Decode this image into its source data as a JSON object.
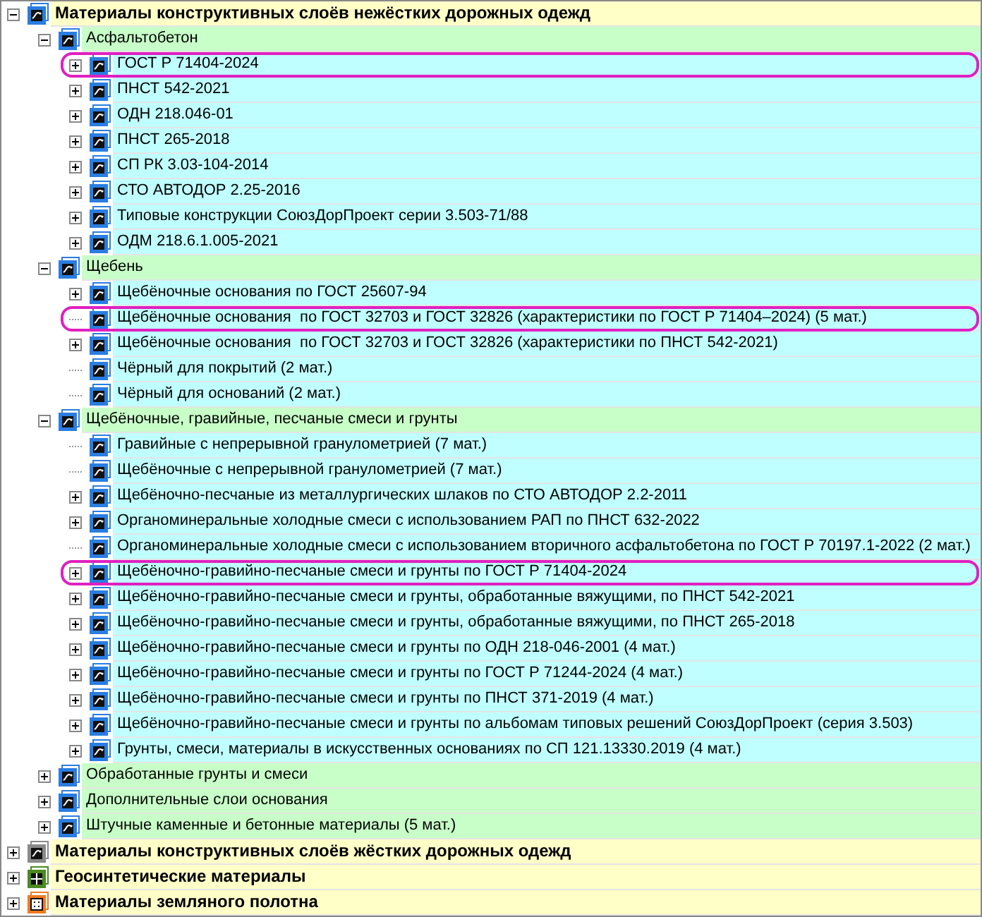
{
  "tree": [
    {
      "label": "Материалы конструктивных слоёв нежёстких дорожных одежд",
      "kind": "flexible",
      "expanded": true,
      "children": [
        {
          "label": "Асфальтобетон",
          "expanded": true,
          "children": [
            {
              "label": "ГОСТ Р 71404-2024",
              "expanded": false,
              "highlighted": true
            },
            {
              "label": "ПНСТ 542-2021",
              "expanded": false,
              "highlighted": false
            },
            {
              "label": "ОДН 218.046-01",
              "expanded": false,
              "highlighted": false
            },
            {
              "label": "ПНСТ 265-2018",
              "expanded": false,
              "highlighted": false
            },
            {
              "label": "СП РК 3.03-104-2014",
              "expanded": false,
              "highlighted": false
            },
            {
              "label": "СТО АВТОДОР 2.25-2016",
              "expanded": false,
              "highlighted": false
            },
            {
              "label": "Типовые конструкции СоюзДорПроект серии 3.503-71/88",
              "expanded": false,
              "highlighted": false
            },
            {
              "label": "ОДМ 218.6.1.005-2021",
              "expanded": false,
              "highlighted": false
            }
          ]
        },
        {
          "label": "Щебень",
          "expanded": true,
          "children": [
            {
              "label": "Щебёночные основания по ГОСТ 25607-94",
              "expanded": false,
              "highlighted": false
            },
            {
              "label": "Щебёночные основания  по ГОСТ 32703 и ГОСТ 32826 (характеристики по ГОСТ Р 71404–2024) (5 мат.)",
              "highlighted": true
            },
            {
              "label": "Щебёночные основания  по ГОСТ 32703 и ГОСТ 32826 (характеристики по ПНСТ 542-2021)",
              "expanded": false,
              "highlighted": false
            },
            {
              "label": "Чёрный для покрытий (2 мат.)",
              "highlighted": false
            },
            {
              "label": "Чёрный для оснований (2 мат.)",
              "highlighted": false
            }
          ]
        },
        {
          "label": "Щебёночные, гравийные, песчаные смеси и грунты",
          "expanded": true,
          "children": [
            {
              "label": "Гравийные с непрерывной гранулометрией (7 мат.)",
              "highlighted": false
            },
            {
              "label": "Щебёночные с непрерывной гранулометрией (7 мат.)",
              "highlighted": false
            },
            {
              "label": "Щебёночно-песчаные из металлургических шлаков по СТО АВТОДОР 2.2-2011",
              "expanded": false,
              "highlighted": false
            },
            {
              "label": "Органоминеральные холодные смеси с использованием РАП по ПНСТ 632-2022",
              "expanded": false,
              "highlighted": false
            },
            {
              "label": "Органоминеральные холодные смеси с использованием вторичного асфальтобетона по ГОСТ Р 70197.1-2022 (2 мат.)",
              "highlighted": false
            },
            {
              "label": "Щебёночно-гравийно-песчаные смеси и грунты по ГОСТ Р 71404-2024",
              "expanded": false,
              "highlighted": true
            },
            {
              "label": "Щебёночно-гравийно-песчаные смеси и грунты, обработанные вяжущими, по ПНСТ 542-2021",
              "expanded": false,
              "highlighted": false
            },
            {
              "label": "Щебёночно-гравийно-песчаные смеси и грунты, обработанные вяжущими, по ПНСТ 265-2018",
              "expanded": false,
              "highlighted": false
            },
            {
              "label": "Щебёночно-гравийно-песчаные смеси и грунты по ОДН 218-046-2001 (4 мат.)",
              "expanded": false,
              "highlighted": false
            },
            {
              "label": "Щебёночно-гравийно-песчаные смеси и грунты по ГОСТ Р 71244-2024 (4 мат.)",
              "expanded": false,
              "highlighted": false
            },
            {
              "label": "Щебёночно-гравийно-песчаные смеси и грунты по ПНСТ 371-2019 (4 мат.)",
              "expanded": false,
              "highlighted": false
            },
            {
              "label": "Щебёночно-гравийно-песчаные смеси и грунты по альбомам типовых решений СоюзДорПроект (серия 3.503)",
              "expanded": false,
              "highlighted": false
            },
            {
              "label": "Грунты, смеси, материалы в искусственных основаниях по СП 121.13330.2019 (4 мат.)",
              "expanded": false,
              "highlighted": false
            }
          ]
        },
        {
          "label": "Обработанные грунты и смеси",
          "expanded": false
        },
        {
          "label": "Дополнительные слои основания",
          "expanded": false
        },
        {
          "label": "Штучные каменные и бетонные материалы (5 мат.)",
          "expanded": false
        }
      ]
    },
    {
      "label": "Материалы конструктивных слоёв жёстких дорожных одежд",
      "kind": "rigid",
      "expanded": false
    },
    {
      "label": "Геосинтетические материалы",
      "kind": "geosynthetic",
      "expanded": false
    },
    {
      "label": "Материалы земляного полотна",
      "kind": "earthwork",
      "expanded": false
    }
  ]
}
